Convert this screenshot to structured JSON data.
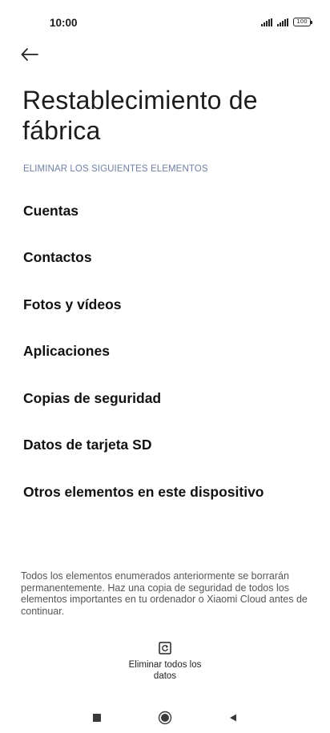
{
  "status_bar": {
    "time": "10:00",
    "battery": "100"
  },
  "header": {
    "back_icon": "arrow-left-icon",
    "title": "Restablecimiento de fábrica"
  },
  "section": {
    "label": "ELIMINAR LOS SIGUIENTES ELEMENTOS",
    "items": [
      "Cuentas",
      "Contactos",
      "Fotos y vídeos",
      "Aplicaciones",
      "Copias de seguridad",
      "Datos de tarjeta SD",
      "Otros elementos en este dispositivo"
    ]
  },
  "note": "Todos los elementos enumerados anteriormente se borrarán permanentemente. Haz una copia de seguridad de todos los elementos importantes en tu ordenador o Xiaomi Cloud antes de continuar.",
  "action": {
    "icon": "reset-icon",
    "label": "Eliminar todos los datos"
  },
  "nav_bar": {
    "recent_icon": "square-icon",
    "home_icon": "circle-icon",
    "back_icon": "triangle-back-icon"
  }
}
